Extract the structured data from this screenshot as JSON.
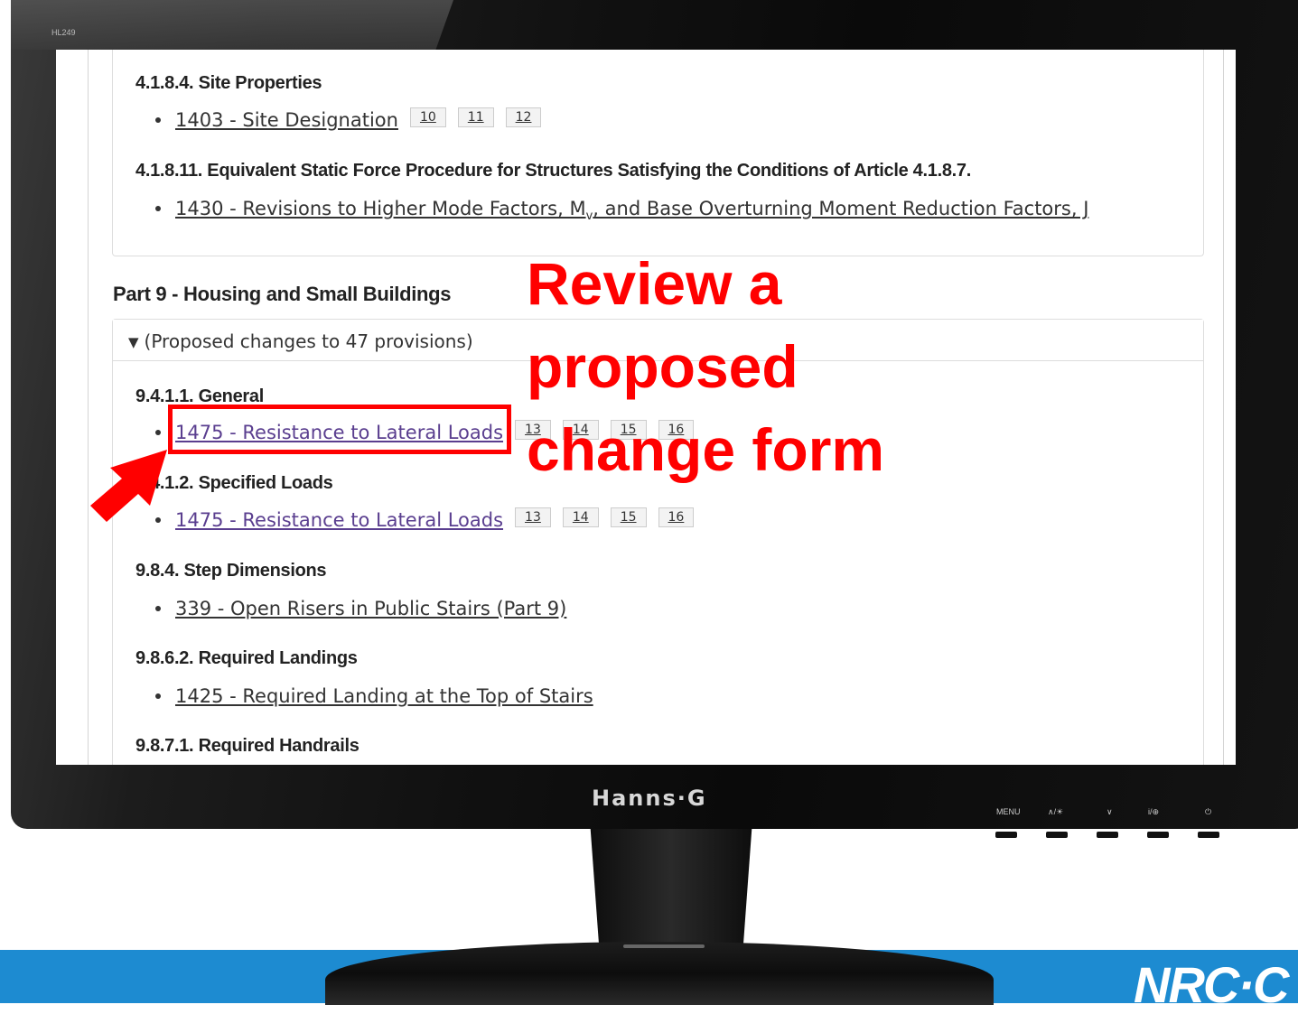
{
  "monitor": {
    "model": "HL249",
    "brand": "Hanns·G",
    "controls": [
      "MENU",
      "∧/☀",
      "∨",
      "i/⊕",
      "⏻"
    ]
  },
  "footer": {
    "logo": "NRC·C"
  },
  "callout": {
    "lines": [
      "Review a",
      "proposed",
      "change form"
    ],
    "color": "#ff0000"
  },
  "sections": [
    {
      "heading": "4.1.8.4. Site Properties",
      "items": [
        {
          "link": "1403 - Site Designation",
          "visited": false,
          "tags": [
            "10",
            "11",
            "12"
          ]
        }
      ]
    },
    {
      "heading": "4.1.8.11. Equivalent Static Force Procedure for Structures Satisfying the Conditions of Article 4.1.8.7.",
      "items": [
        {
          "link_prefix": "1430 - Revisions to Higher Mode Factors, M",
          "link_sub": "v",
          "link_suffix": ", and Base Overturning Moment Reduction Factors, J",
          "visited": false,
          "tags": []
        }
      ]
    }
  ],
  "part9": {
    "title": "Part 9 - Housing and Small Buildings",
    "toggle_label": "(Proposed changes to 47 provisions)",
    "sections": [
      {
        "heading": "9.4.1.1. General",
        "items": [
          {
            "link": "1475 - Resistance to Lateral Loads",
            "visited": true,
            "tags": [
              "13",
              "14",
              "15",
              "16"
            ]
          }
        ]
      },
      {
        "heading": "9.4.1.2. Specified Loads",
        "items": [
          {
            "link": "1475 - Resistance to Lateral Loads",
            "visited": true,
            "tags": [
              "13",
              "14",
              "15",
              "16"
            ]
          }
        ]
      },
      {
        "heading": "9.8.4. Step Dimensions",
        "items": [
          {
            "link": "339 - Open Risers in Public Stairs (Part 9)",
            "visited": false,
            "tags": []
          }
        ]
      },
      {
        "heading": "9.8.6.2. Required Landings",
        "items": [
          {
            "link": "1425 - Required Landing at the Top of Stairs",
            "visited": false,
            "tags": []
          }
        ]
      },
      {
        "heading": "9.8.7.1. Required Handrails",
        "items": []
      }
    ]
  }
}
